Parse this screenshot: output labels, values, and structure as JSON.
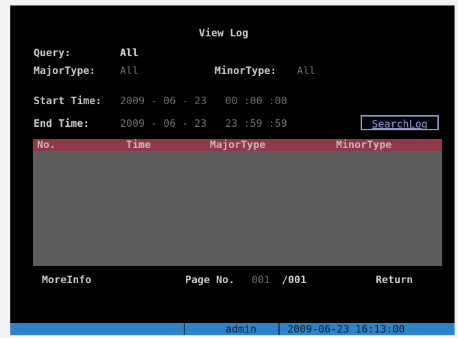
{
  "window": {
    "title": "View Log"
  },
  "form": {
    "query_label": "Query:",
    "query_value": "All",
    "major_type_label": "MajorType:",
    "major_type_value": "All",
    "minor_type_label": "MinorType:",
    "minor_type_value": "All",
    "start_time_label": "Start Time:",
    "start_time_value": "2009 - 06 - 23   00 :00 :00",
    "end_time_label": "End Time:",
    "end_time_value": "2009 - 06 - 23   23 :59 :59",
    "search_label": "SearchLog"
  },
  "table": {
    "columns": [
      "No.",
      "Time",
      "MajorType",
      "MinorType"
    ],
    "rows": []
  },
  "footer": {
    "more_info_label": "MoreInfo",
    "page_label": "Page No.",
    "page_current": "001",
    "page_total": "/001",
    "return_label": "Return"
  },
  "status_bar": {
    "user": "admin",
    "datetime": "2009-06-23 16:13:00"
  },
  "colors": {
    "background": "#000000",
    "header_row": "#8e3848",
    "table_body": "#5d5d5d",
    "status_bar": "#2f82c6",
    "button_border": "#9d9dc8"
  }
}
